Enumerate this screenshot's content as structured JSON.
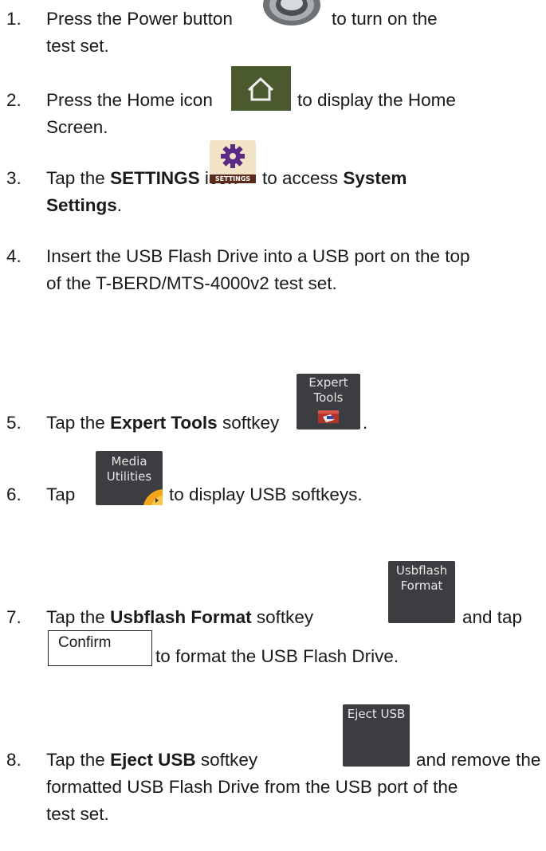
{
  "steps": [
    {
      "num": "1.",
      "a": "Press the Power button",
      "b": "to turn on the",
      "c": "test set."
    },
    {
      "num": "2.",
      "a": "Press the Home icon",
      "b": "to display the Home",
      "c": "Screen."
    },
    {
      "num": "3.",
      "a": "Tap the",
      "b_bold": "SETTINGS",
      "c": "icon",
      "d": "to access",
      "e_bold": "System",
      "f_bold": "Settings",
      "g": "."
    },
    {
      "num": "4.",
      "a": "Insert the USB Flash Drive into a USB port on the top",
      "b": "of the T-BERD/MTS-4000v2 test set."
    },
    {
      "num": "5.",
      "a": "Tap the",
      "b_bold": "Expert Tools",
      "c": "softkey",
      "d": "."
    },
    {
      "num": "6.",
      "a": "Tap",
      "b": "to display USB softkeys."
    },
    {
      "num": "7.",
      "a": "Tap the",
      "b_bold": "Usbflash Format",
      "c": "softkey",
      "d": "and tap",
      "e": "to format the USB Flash Drive."
    },
    {
      "num": "8.",
      "a": "Tap the",
      "b_bold": "Eject USB",
      "c": "softkey",
      "d": "and remove the",
      "e": "formatted USB Flash Drive from the USB port of the",
      "f": "test set."
    }
  ],
  "icons": {
    "settings_label": "SETTINGS",
    "expert_tools_line1": "Expert",
    "expert_tools_line2": "Tools",
    "media_line1": "Media",
    "media_line2": "Utilities",
    "usbflash_line1": "Usbflash",
    "usbflash_line2": "Format",
    "confirm_label": "Confirm",
    "eject_label": "Eject USB"
  }
}
